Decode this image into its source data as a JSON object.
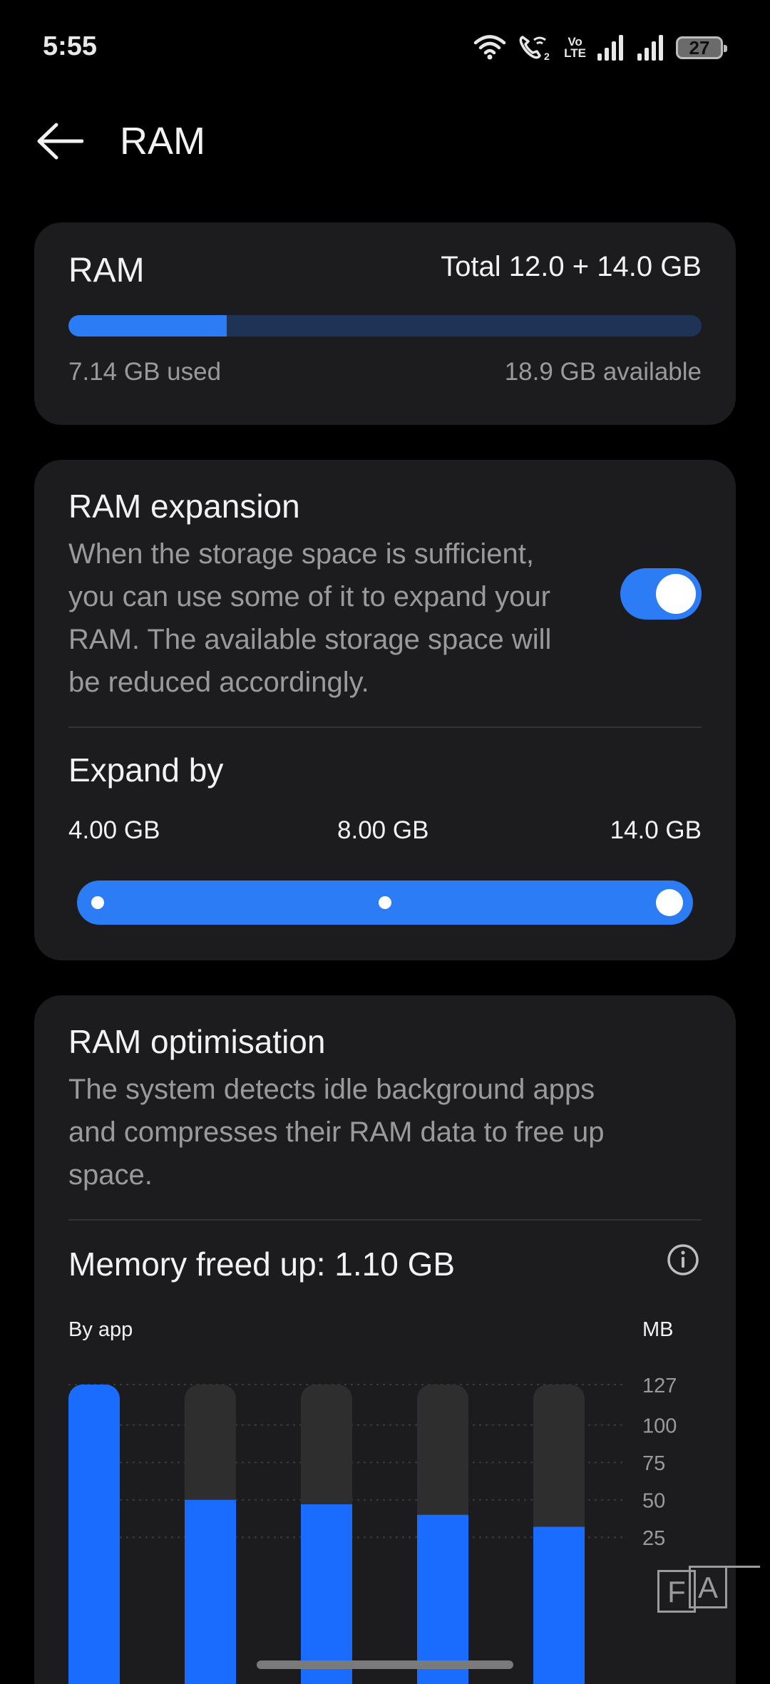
{
  "status_bar": {
    "time": "5:55",
    "volte_top": "Vo",
    "volte_bottom": "LTE",
    "battery": "27",
    "icons": [
      "wifi-icon",
      "wifi-calling-icon",
      "volte-icon",
      "signal-icon",
      "signal-icon",
      "battery-icon"
    ]
  },
  "header": {
    "back_icon": "arrow-left-icon",
    "title": "RAM"
  },
  "ram_card": {
    "title": "RAM",
    "total": "Total 12.0 + 14.0 GB",
    "used": "7.14 GB used",
    "available": "18.9 GB available",
    "used_fraction": 0.25,
    "bar_fill_color": "#2b7cf5",
    "bar_track_color": "#1f3357"
  },
  "expansion_card": {
    "title": "RAM expansion",
    "description_lines": [
      "When the storage space is sufficient,",
      "you can use some of it to expand your",
      "RAM. The available storage space will",
      "be reduced accordingly."
    ],
    "toggle_on": true,
    "expand_title": "Expand by",
    "options": [
      "4.00 GB",
      "8.00 GB",
      "14.0 GB"
    ],
    "selected_option": "14.0 GB",
    "accent": "#2b7cf5"
  },
  "optimisation_card": {
    "title": "RAM optimisation",
    "description_lines": [
      "The system detects idle background apps",
      "and compresses their RAM data to free up",
      "space."
    ],
    "memory_freed": "Memory freed up: 1.10 GB",
    "info_icon": "info-icon",
    "chart_label_left": "By app",
    "chart_label_right": "MB"
  },
  "chart_data": {
    "type": "bar",
    "ylabel": "MB",
    "ylim": [
      0,
      127
    ],
    "y_ticks": [
      127,
      100,
      75,
      50,
      25
    ],
    "values": [
      127,
      50,
      47,
      40,
      32
    ],
    "bar_color": "#1a6cff",
    "track_color": "#2e2e2e"
  },
  "watermark": {
    "letters": [
      "F",
      "A"
    ]
  }
}
